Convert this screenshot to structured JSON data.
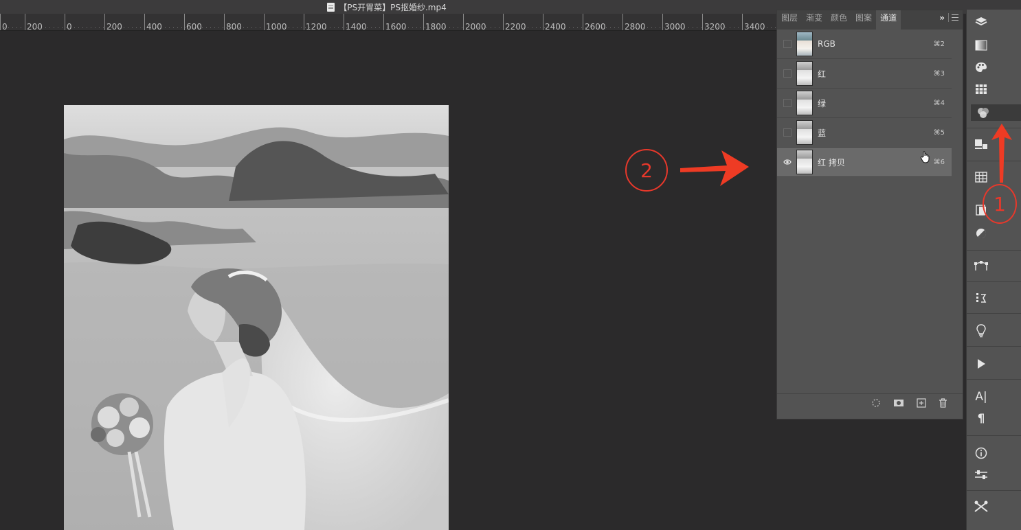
{
  "window": {
    "title": "【PS开胃菜】PS抠婚纱.mp4"
  },
  "ruler": {
    "labels": [
      "0",
      "200",
      "0",
      "200",
      "400",
      "600",
      "800",
      "1000",
      "1200",
      "1400",
      "1600",
      "1800",
      "2000",
      "2200",
      "2400",
      "2600",
      "2800",
      "3000",
      "3200",
      "3400"
    ]
  },
  "channels_panel": {
    "tabs": [
      "图层",
      "渐变",
      "颜色",
      "图案",
      "通道"
    ],
    "active_tab": "通道",
    "more_glyph": "»",
    "channels": [
      {
        "label": "RGB",
        "shortcut": "⌘2",
        "visible": false
      },
      {
        "label": "红",
        "shortcut": "⌘3",
        "visible": false
      },
      {
        "label": "绿",
        "shortcut": "⌘4",
        "visible": false
      },
      {
        "label": "蓝",
        "shortcut": "⌘5",
        "visible": false
      },
      {
        "label": "红 拷贝",
        "shortcut": "⌘6",
        "visible": true,
        "selected": true
      }
    ]
  },
  "annotations": {
    "step1": "1",
    "step2": "2",
    "color": "#e8382b"
  },
  "iconbar": {
    "icons": [
      "layers-icon",
      "gradient-icon",
      "palette-icon",
      "swatches-icon",
      "channels-icon",
      "libraries-icon",
      "grid-icon",
      "properties-icon",
      "adjustments-icon",
      "paths-icon",
      "history-icon",
      "lightbulb-icon",
      "play-icon",
      "character-icon",
      "paragraph-icon",
      "info-icon",
      "tool-presets-icon",
      "brush-settings-icon"
    ]
  }
}
